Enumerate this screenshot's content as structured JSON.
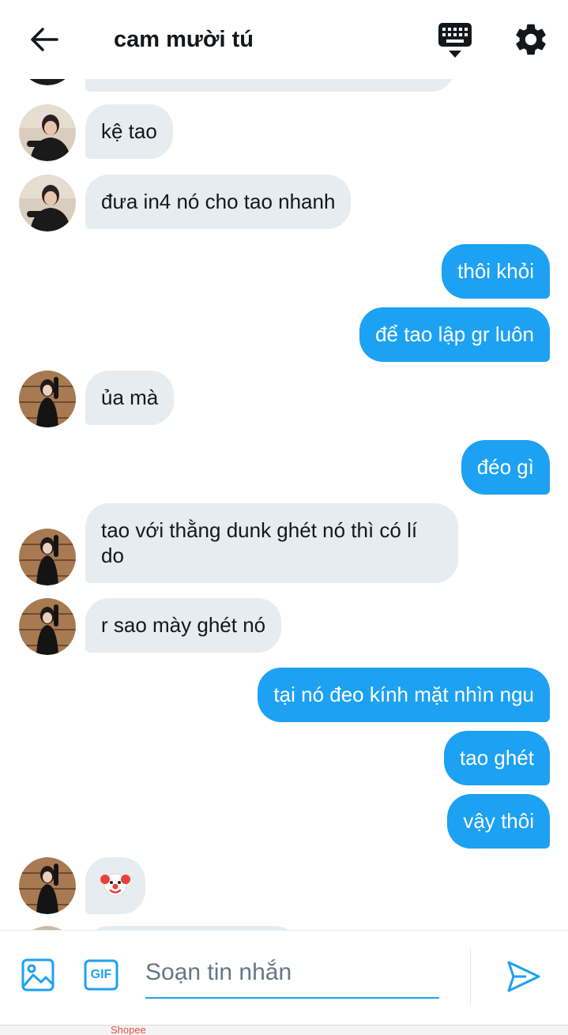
{
  "header": {
    "title": "cam mười tú",
    "icons": {
      "back": "arrow-left-icon",
      "keyboard": "keyboard-icon",
      "settings": "gear-icon"
    }
  },
  "conversation": [
    {
      "dir": "in",
      "text": "",
      "partial": true
    },
    {
      "dir": "in",
      "text": "kệ tao",
      "avatar": "avatar-a"
    },
    {
      "dir": "in",
      "text": "đưa in4 nó cho tao nhanh",
      "avatar": "avatar-a"
    },
    {
      "dir": "out",
      "text": "thôi khỏi"
    },
    {
      "dir": "out",
      "text": "để tao lập gr luôn"
    },
    {
      "dir": "in",
      "text": "ủa mà",
      "avatar": "avatar-b"
    },
    {
      "dir": "out",
      "text": "đéo gì"
    },
    {
      "dir": "in",
      "text": "tao với thằng dunk ghét nó thì có lí do",
      "avatar": "avatar-b"
    },
    {
      "dir": "in",
      "text": "r sao mày ghét nó",
      "avatar": "avatar-b"
    },
    {
      "dir": "out",
      "text": "tại nó đeo kính mặt nhìn ngu"
    },
    {
      "dir": "out",
      "text": "tao ghét"
    },
    {
      "dir": "out",
      "text": "vậy thôi"
    },
    {
      "dir": "in",
      "text": "🤡",
      "avatar": "avatar-b"
    }
  ],
  "composer": {
    "placeholder": "Soạn tin nhắn",
    "value": "",
    "gif_label": "GIF",
    "icons": {
      "image": "image-icon",
      "gif": "gif-icon",
      "send": "send-icon"
    }
  },
  "bottom_bar": {
    "partial_text": "Shopee"
  },
  "colors": {
    "accent": "#1da1f2",
    "incoming_bubble": "#e6ecf0",
    "text": "#14171a",
    "placeholder": "#657786"
  }
}
